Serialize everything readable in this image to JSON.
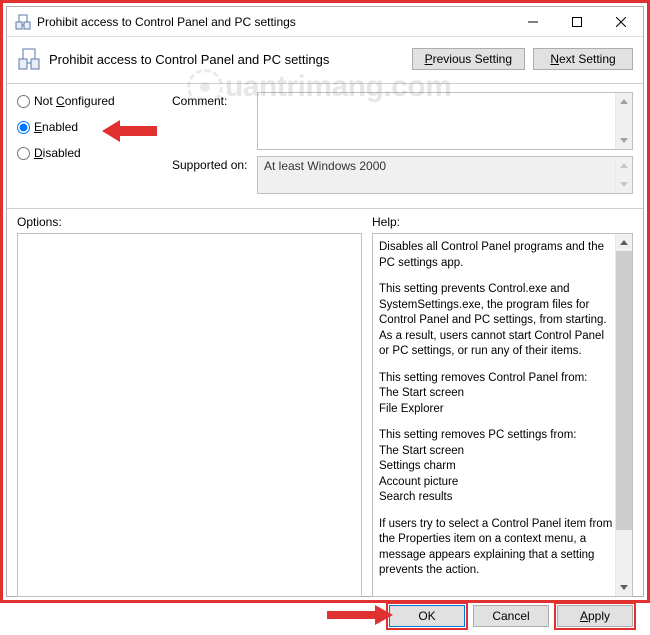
{
  "window": {
    "title": "Prohibit access to Control Panel and PC settings"
  },
  "header": {
    "title": "Prohibit access to Control Panel and PC settings",
    "prev_btn_prefix": "P",
    "prev_btn_rest": "revious Setting",
    "next_btn_prefix": "N",
    "next_btn_rest": "ext Setting"
  },
  "policy_state": {
    "not_configured_ul": "C",
    "not_configured_rest": "onfigured",
    "not_configured_pre": "Not ",
    "enabled_ul": "E",
    "enabled_rest": "nabled",
    "disabled_ul": "D",
    "disabled_rest": "isabled",
    "selected": "enabled"
  },
  "fields": {
    "comment_label": "Comment:",
    "comment_value": "",
    "supported_label": "Supported on:",
    "supported_value": "At least Windows 2000"
  },
  "lower": {
    "options_label": "Options:",
    "help_label": "Help:"
  },
  "help": {
    "p1": "Disables all Control Panel programs and the PC settings app.",
    "p2": "This setting prevents Control.exe and SystemSettings.exe, the program files for Control Panel and PC settings, from starting. As a result, users cannot start Control Panel or PC settings, or run any of their items.",
    "p3_l1": "This setting removes Control Panel from:",
    "p3_l2": "The Start screen",
    "p3_l3": "File Explorer",
    "p4_l1": "This setting removes PC settings from:",
    "p4_l2": "The Start screen",
    "p4_l3": "Settings charm",
    "p4_l4": "Account picture",
    "p4_l5": "Search results",
    "p5": "If users try to select a Control Panel item from the Properties item on a context menu, a message appears explaining that a setting prevents the action."
  },
  "footer": {
    "ok": "OK",
    "cancel": "Cancel",
    "apply_ul": "A",
    "apply_rest": "pply"
  },
  "watermark": "uantrimang.com"
}
